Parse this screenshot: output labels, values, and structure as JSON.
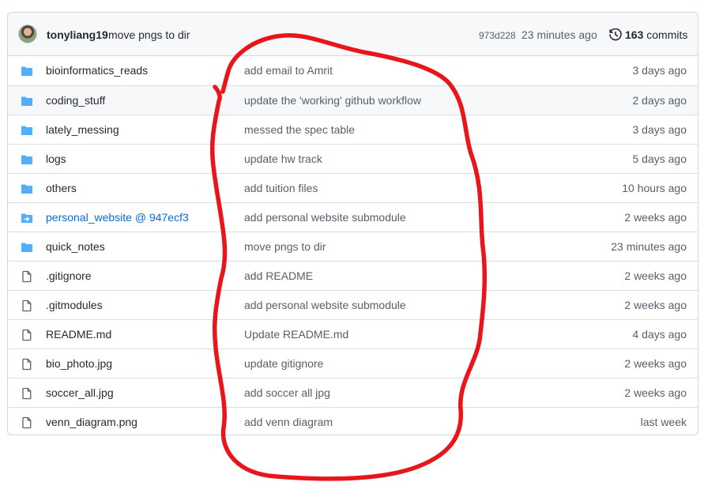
{
  "commit": {
    "author": "tonyliang19",
    "message": "move pngs to dir",
    "sha": "973d228",
    "time": "23 minutes ago",
    "commits_count": "163",
    "commits_label": " commits"
  },
  "files": [
    {
      "name": "bioinformatics_reads",
      "icon": "folder-icon",
      "message": "add email to Amrit",
      "age": "3 days ago"
    },
    {
      "name": "coding_stuff",
      "icon": "folder-icon",
      "message": "update the 'working' github workflow",
      "age": "2 days ago"
    },
    {
      "name": "lately_messing",
      "icon": "folder-icon",
      "message": "messed the spec table",
      "age": "3 days ago"
    },
    {
      "name": "logs",
      "icon": "folder-icon",
      "message": "update hw track",
      "age": "5 days ago"
    },
    {
      "name": "others",
      "icon": "folder-icon",
      "message": "add tuition files",
      "age": "10 hours ago"
    },
    {
      "name": "personal_website @ 947ecf3",
      "icon": "submodule-icon",
      "message": "add personal website submodule",
      "age": "2 weeks ago"
    },
    {
      "name": "quick_notes",
      "icon": "folder-icon",
      "message": "move pngs to dir",
      "age": "23 minutes ago"
    },
    {
      "name": ".gitignore",
      "icon": "file-icon",
      "message": "add README",
      "age": "2 weeks ago"
    },
    {
      "name": ".gitmodules",
      "icon": "file-icon",
      "message": "add personal website submodule",
      "age": "2 weeks ago"
    },
    {
      "name": "README.md",
      "icon": "file-icon",
      "message": "Update README.md",
      "age": "4 days ago"
    },
    {
      "name": "bio_photo.jpg",
      "icon": "file-icon",
      "message": "update gitignore",
      "age": "2 weeks ago"
    },
    {
      "name": "soccer_all.jpg",
      "icon": "file-icon",
      "message": "add soccer all jpg",
      "age": "2 weeks ago"
    },
    {
      "name": "venn_diagram.png",
      "icon": "file-icon",
      "message": "add venn diagram",
      "age": "last week"
    }
  ],
  "colors": {
    "folder": "#54aeff",
    "link": "#0969da",
    "annotation": "#e8151b"
  }
}
